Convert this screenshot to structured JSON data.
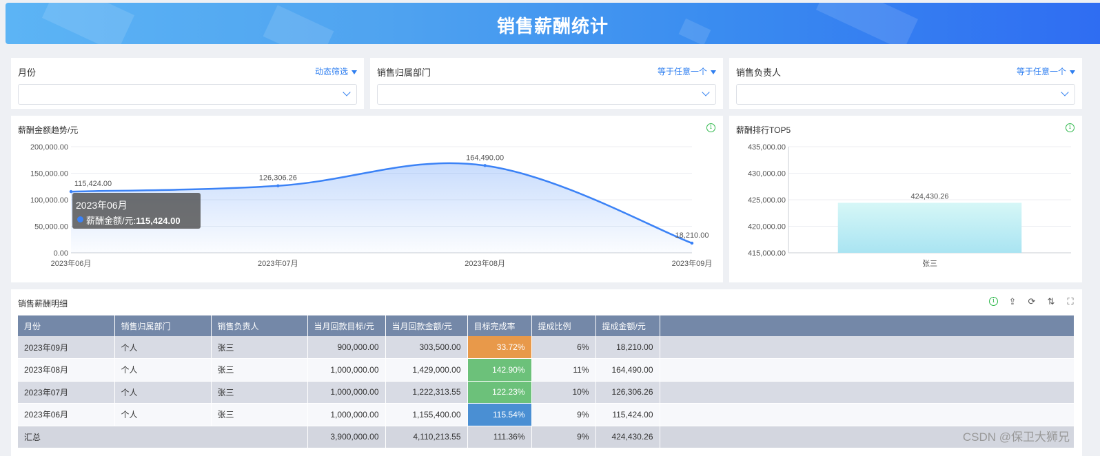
{
  "header": {
    "title": "销售薪酬统计"
  },
  "filters": [
    {
      "label": "月份",
      "mode": "动态筛选"
    },
    {
      "label": "销售归属部门",
      "mode": "等于任意一个"
    },
    {
      "label": "销售负责人",
      "mode": "等于任意一个"
    }
  ],
  "trend": {
    "title": "薪酬金额趋势/元",
    "tooltip": {
      "title": "2023年06月",
      "series": "薪酬金额/元:",
      "value": "115,424.00"
    }
  },
  "top5": {
    "title": "薪酬排行TOP5"
  },
  "chart_data": [
    {
      "type": "area",
      "title": "薪酬金额趋势/元",
      "categories": [
        "2023年06月",
        "2023年07月",
        "2023年08月",
        "2023年09月"
      ],
      "values": [
        115424.0,
        126306.26,
        164490.0,
        18210.0
      ],
      "data_labels": [
        "115,424.00",
        "126,306.26",
        "164,490.00",
        "18,210.00"
      ],
      "y_ticks": [
        "0.00",
        "50,000.00",
        "100,000.00",
        "150,000.00",
        "200,000.00"
      ],
      "ylim": [
        0,
        200000
      ],
      "color": "#3b82f6"
    },
    {
      "type": "bar",
      "title": "薪酬排行TOP5",
      "categories": [
        "张三"
      ],
      "values": [
        424430.26
      ],
      "data_labels": [
        "424,430.26"
      ],
      "y_ticks": [
        "415,000.00",
        "420,000.00",
        "425,000.00",
        "430,000.00",
        "435,000.00"
      ],
      "ylim": [
        415000,
        435000
      ],
      "color": "#c8f3f6"
    }
  ],
  "detail": {
    "title": "销售薪酬明细",
    "columns": [
      "月份",
      "销售归属部门",
      "销售负责人",
      "当月回款目标/元",
      "当月回款金额/元",
      "目标完成率",
      "提成比例",
      "提成金额/元"
    ],
    "rows": [
      {
        "month": "2023年09月",
        "dept": "个人",
        "owner": "张三",
        "target": "900,000.00",
        "amount": "303,500.00",
        "rate": "33.72%",
        "rate_color": "#e8994a",
        "ratio": "6%",
        "commission": "18,210.00"
      },
      {
        "month": "2023年08月",
        "dept": "个人",
        "owner": "张三",
        "target": "1,000,000.00",
        "amount": "1,429,000.00",
        "rate": "142.90%",
        "rate_color": "#6cc17a",
        "ratio": "11%",
        "commission": "164,490.00"
      },
      {
        "month": "2023年07月",
        "dept": "个人",
        "owner": "张三",
        "target": "1,000,000.00",
        "amount": "1,222,313.55",
        "rate": "122.23%",
        "rate_color": "#6cc17a",
        "ratio": "10%",
        "commission": "126,306.26"
      },
      {
        "month": "2023年06月",
        "dept": "个人",
        "owner": "张三",
        "target": "1,000,000.00",
        "amount": "1,155,400.00",
        "rate": "115.54%",
        "rate_color": "#4a8fd3",
        "ratio": "9%",
        "commission": "115,424.00"
      }
    ],
    "total": {
      "label": "汇总",
      "target": "3,900,000.00",
      "amount": "4,110,213.55",
      "rate": "111.36%",
      "ratio": "9%",
      "commission": "424,430.26"
    }
  },
  "watermark": "CSDN @保卫大狮兄"
}
